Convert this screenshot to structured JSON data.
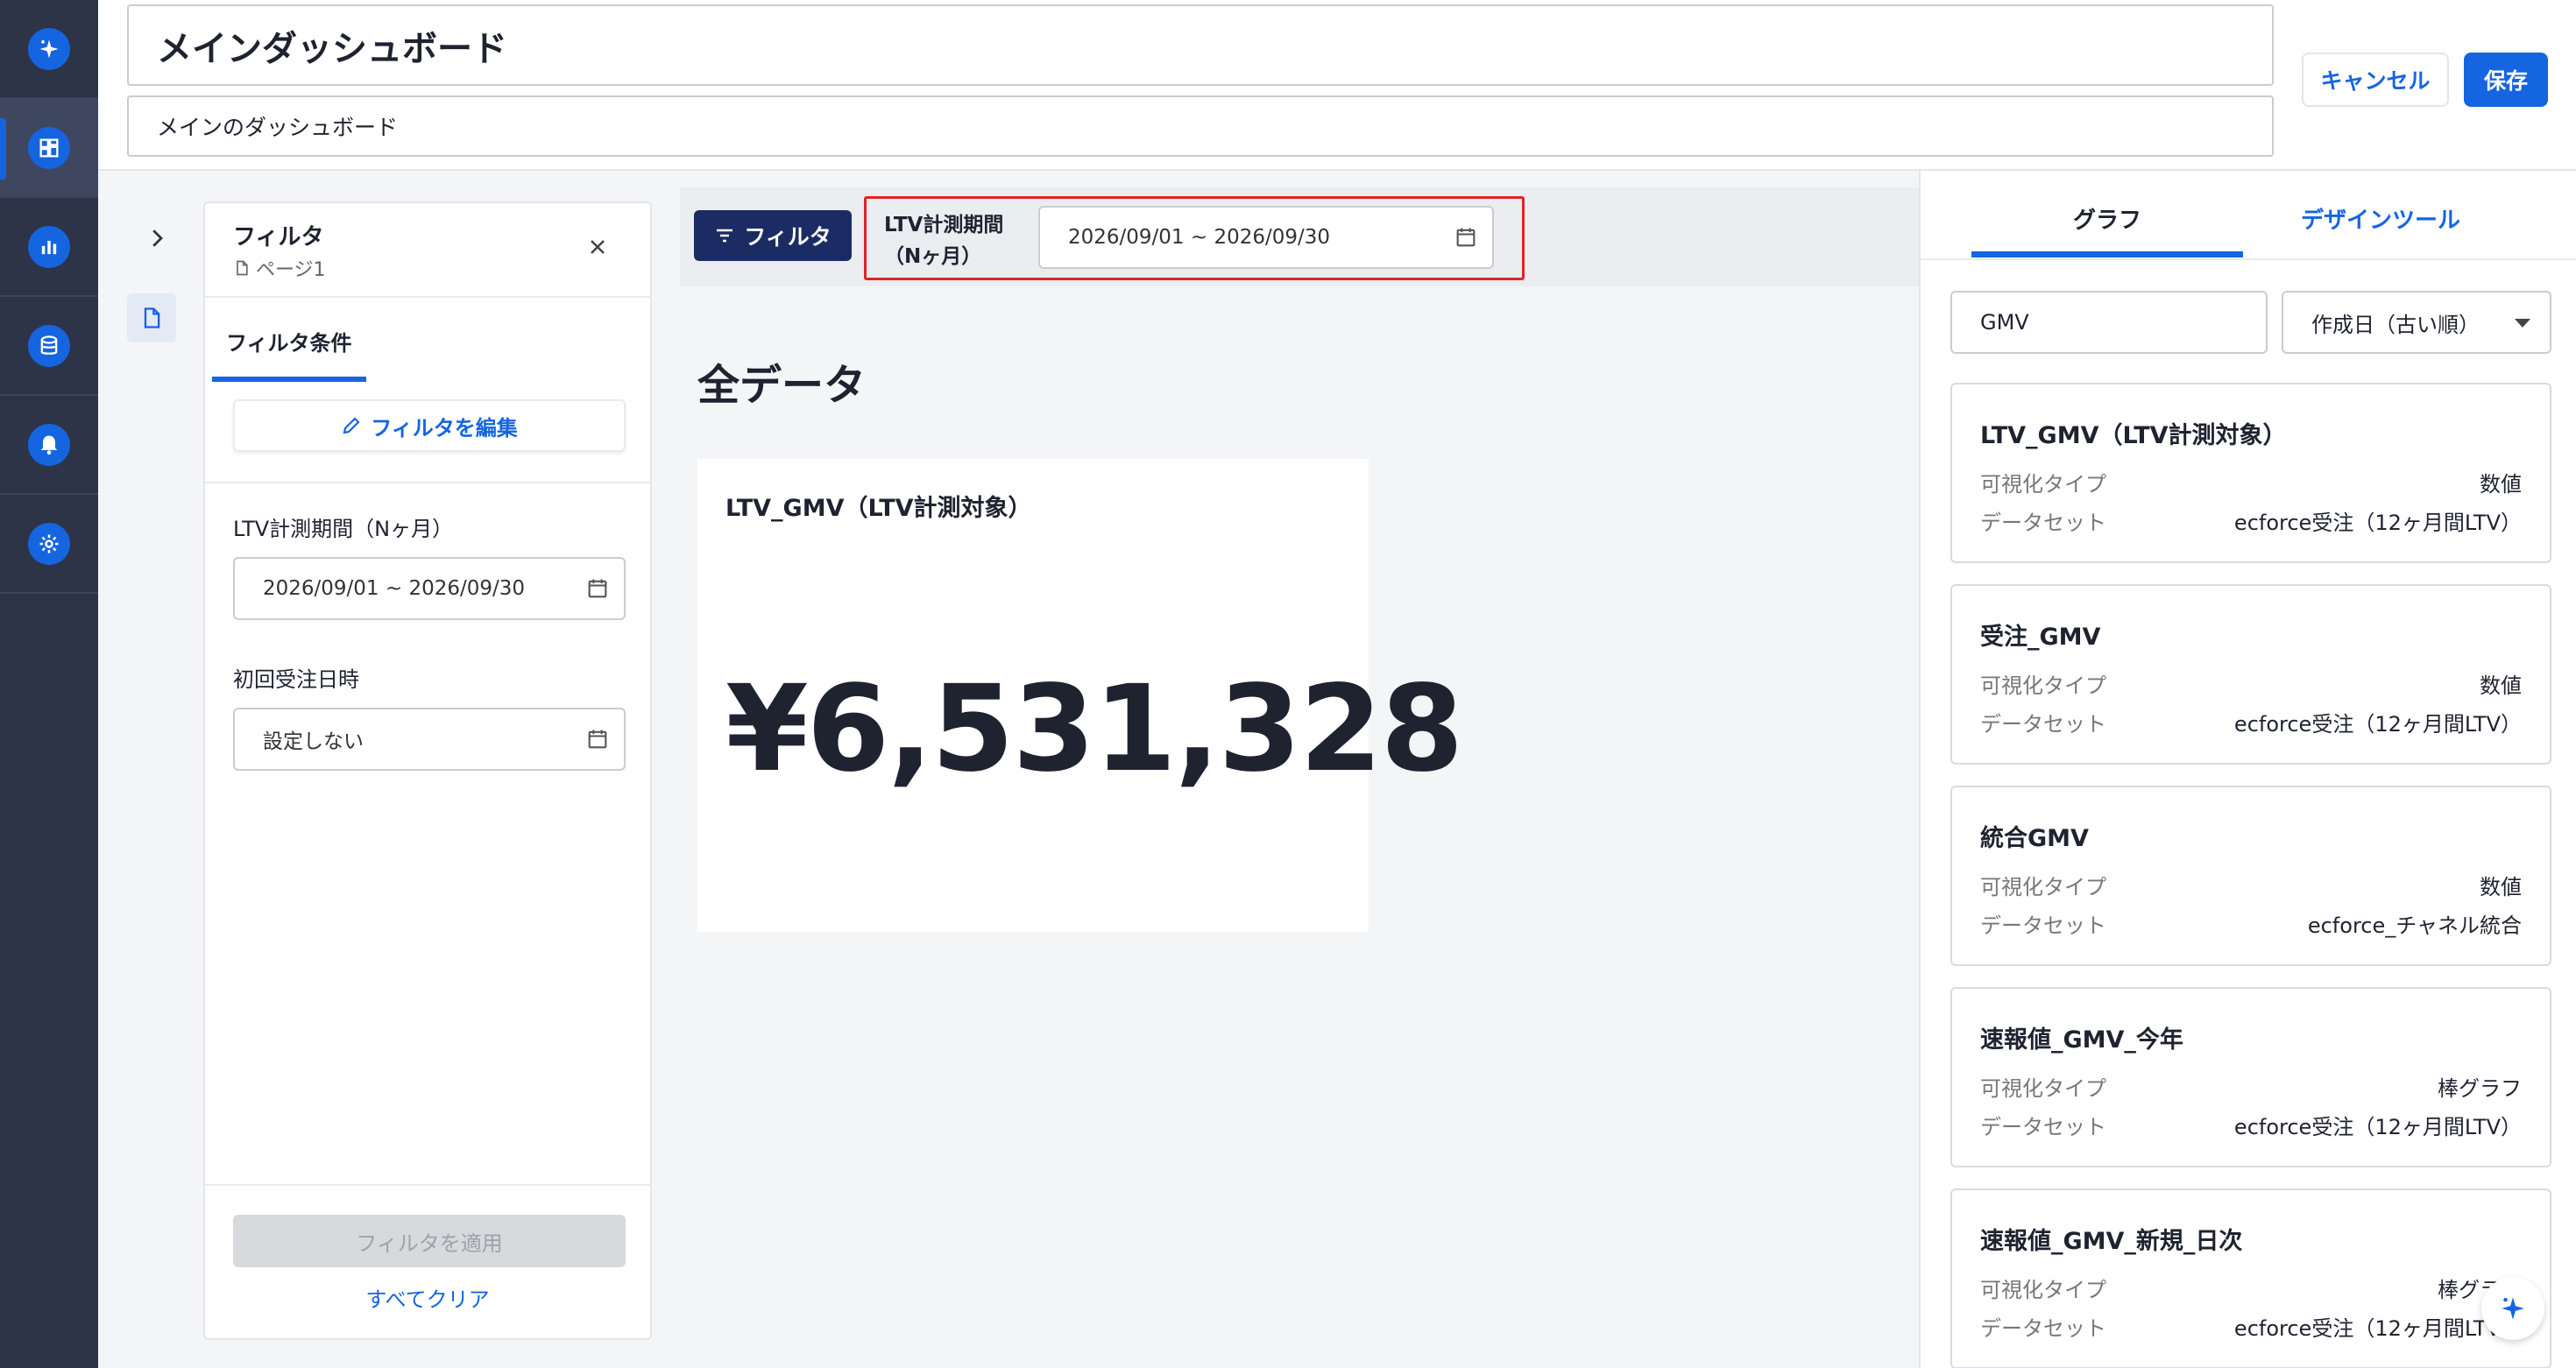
{
  "header": {
    "title": "メインダッシュボード",
    "subtitle": "メインのダッシュボード",
    "cancel_label": "キャンセル",
    "save_label": "保存"
  },
  "rail": {
    "items": [
      {
        "icon": "sparkle-icon"
      },
      {
        "icon": "dashboard-icon",
        "active": true
      },
      {
        "icon": "bar-chart-icon"
      },
      {
        "icon": "database-icon"
      },
      {
        "icon": "bell-icon"
      },
      {
        "icon": "gear-icon"
      }
    ]
  },
  "filter_panel": {
    "title": "フィルタ",
    "page": "ページ1",
    "tab_label": "フィルタ条件",
    "edit_label": "フィルタを編集",
    "fields": [
      {
        "label": "LTV計測期間（Nヶ月）",
        "value": "2026/09/01 ~ 2026/09/30"
      },
      {
        "label": "初回受注日時",
        "value": "設定しない"
      }
    ],
    "apply_label": "フィルタを適用",
    "clear_label": "すべてクリア"
  },
  "filter_bar": {
    "button_label": "フィルタ",
    "field_label_line1": "LTV計測期間",
    "field_label_line2": "（Nヶ月）",
    "field_value": "2026/09/01 ~ 2026/09/30"
  },
  "main": {
    "section_title": "全データ",
    "card": {
      "title": "LTV_GMV（LTV計測対象）",
      "value": "¥6,531,328"
    }
  },
  "right_panel": {
    "tabs": [
      "グラフ",
      "デザインツール"
    ],
    "search_value": "GMV",
    "sort_value": "作成日（古い順）",
    "key_type": "可視化タイプ",
    "key_dataset": "データセット",
    "items": [
      {
        "name": "LTV_GMV（LTV計測対象）",
        "type": "数値",
        "dataset": "ecforce受注（12ヶ月間LTV）"
      },
      {
        "name": "受注_GMV",
        "type": "数値",
        "dataset": "ecforce受注（12ヶ月間LTV）"
      },
      {
        "name": "統合GMV",
        "type": "数値",
        "dataset": "ecforce_チャネル統合"
      },
      {
        "name": "速報値_GMV_今年",
        "type": "棒グラフ",
        "dataset": "ecforce受注（12ヶ月間LTV）"
      },
      {
        "name": "速報値_GMV_新規_日次",
        "type": "棒グラフ",
        "dataset": "ecforce受注（12ヶ月間LTV）"
      }
    ]
  },
  "colors": {
    "accent": "#1565e0",
    "rail": "#2e3447",
    "filter_button": "#1a2c63",
    "highlight_frame": "#e02424"
  }
}
